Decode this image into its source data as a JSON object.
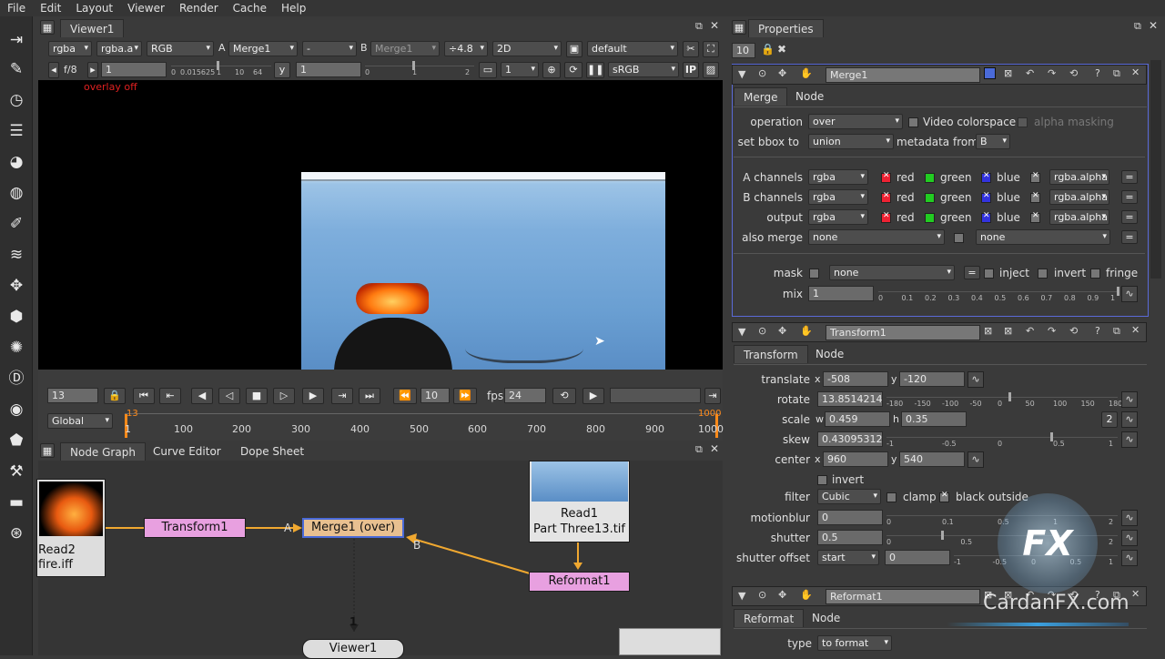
{
  "menu": [
    "File",
    "Edit",
    "Layout",
    "Viewer",
    "Render",
    "Cache",
    "Help"
  ],
  "viewer": {
    "tab": "Viewer1",
    "row1": {
      "ch1": "rgba",
      "ch2": "rgba.a",
      "ch3": "RGB",
      "a_label": "A",
      "a_input": "Merge1",
      "op": "-",
      "b_label": "B",
      "b_input": "Merge1",
      "gain": "÷4.8",
      "mode": "2D",
      "lut": "default"
    },
    "row2": {
      "fstop": "f/8",
      "gain_val": "1",
      "gamma_label": "y",
      "gamma_val": "1",
      "proxy": "1",
      "colorspace": "sRGB",
      "ticks_left": [
        "0",
        "0.015625",
        "1",
        "10",
        "64"
      ],
      "ticks_right": [
        "0",
        "1",
        "2"
      ]
    },
    "overlay": "overlay off"
  },
  "timeline": {
    "frame": "13",
    "inc": "10",
    "fps_label": "fps",
    "fps": "24",
    "range": "Global",
    "current_marker": "13",
    "end_marker": "1000",
    "ticks": [
      "1",
      "100",
      "200",
      "300",
      "400",
      "500",
      "600",
      "700",
      "800",
      "900",
      "1000"
    ]
  },
  "nodegraph": {
    "tabs": [
      "Node Graph",
      "Curve Editor",
      "Dope Sheet"
    ],
    "nodes": {
      "read2_name": "Read2",
      "read2_file": "fire.iff",
      "transform": "Transform1",
      "merge": "Merge1 (over)",
      "read1_name": "Read1",
      "read1_file": "Part Three13.tif",
      "reformat": "Reformat1",
      "viewer": "Viewer1"
    },
    "edge_labels": {
      "a": "A",
      "b": "B",
      "viewer_input": "1"
    }
  },
  "properties": {
    "tab": "Properties",
    "max_panels": "10",
    "merge": {
      "name": "Merge1",
      "tabs": [
        "Merge",
        "Node"
      ],
      "operation_label": "operation",
      "operation": "over",
      "video_colorspace": "Video colorspace",
      "alpha_masking": "alpha masking",
      "bbox_label": "set bbox to",
      "bbox": "union",
      "metadata_label": "metadata from",
      "metadata": "B",
      "a_channels_label": "A channels",
      "b_channels_label": "B channels",
      "output_label": "output",
      "also_merge_label": "also merge",
      "channel": "rgba",
      "red": "red",
      "green": "green",
      "blue": "blue",
      "alpha": "rgba.alpha",
      "also_merge": "none",
      "also_merge2": "none",
      "mask_label": "mask",
      "mask": "none",
      "inject": "inject",
      "invert": "invert",
      "fringe": "fringe",
      "mix_label": "mix",
      "mix": "1",
      "mix_ticks": [
        "0",
        "0.1",
        "0.2",
        "0.3",
        "0.4",
        "0.5",
        "0.6",
        "0.7",
        "0.8",
        "0.9",
        "1"
      ]
    },
    "transform": {
      "name": "Transform1",
      "tabs": [
        "Transform",
        "Node"
      ],
      "translate_label": "translate",
      "tx": "-508",
      "ty": "-120",
      "rotate_label": "rotate",
      "rotate": "13.8514214",
      "rotate_ticks": [
        "-180",
        "-150",
        "-100",
        "-50",
        "0",
        "50",
        "100",
        "150",
        "180"
      ],
      "scale_label": "scale",
      "scale_w": "0.459",
      "scale_h": "0.35",
      "scale_count": "2",
      "skew_label": "skew",
      "skew": "0.43095312",
      "skew_ticks": [
        "-1",
        "-0.5",
        "0",
        "0.5",
        "1"
      ],
      "center_label": "center",
      "cx": "960",
      "cy": "540",
      "invert": "invert",
      "filter_label": "filter",
      "filter": "Cubic",
      "clamp": "clamp",
      "black_outside": "black outside",
      "motionblur_label": "motionblur",
      "motionblur": "0",
      "motionblur_ticks": [
        "0",
        "0.1",
        "0.5",
        "1",
        "2"
      ],
      "shutter_label": "shutter",
      "shutter": "0.5",
      "shutter_ticks": [
        "0",
        "0.5",
        "1",
        "2"
      ],
      "shutter_offset_label": "shutter offset",
      "shutter_offset": "start",
      "shutter_offset_val": "0",
      "shutter_offset_ticks": [
        "-1",
        "-0.5",
        "0",
        "0.5",
        "1"
      ]
    },
    "reformat": {
      "name": "Reformat1",
      "tabs": [
        "Reformat",
        "Node"
      ],
      "type_label": "type",
      "type": "to format"
    }
  },
  "watermark": {
    "logo": "FX",
    "site": "CardanFX.com"
  }
}
